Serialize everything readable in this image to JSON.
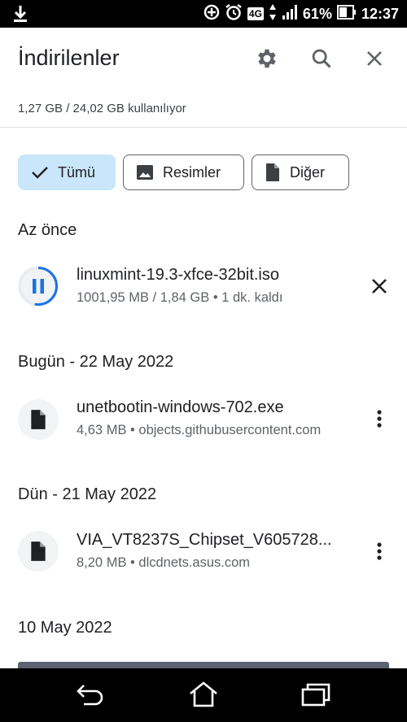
{
  "status_bar": {
    "network": "4G",
    "battery": "61%",
    "time": "12:37"
  },
  "header": {
    "title": "İndirilenler",
    "icons": [
      "gear-icon",
      "search-icon",
      "close-icon"
    ]
  },
  "storage_text": "1,27 GB / 24,02 GB kullanılıyor",
  "chips": [
    {
      "label": "Tümü",
      "icon": "check-icon",
      "selected": true
    },
    {
      "label": "Resimler",
      "icon": "image-icon",
      "selected": false
    },
    {
      "label": "Diğer",
      "icon": "file-icon",
      "selected": false
    }
  ],
  "sections": [
    {
      "heading": "Az önce",
      "items": [
        {
          "name": "linuxmint-19.3-xfce-32bit.iso",
          "meta": "1001,95 MB / 1,84 GB • 1 dk. kaldı",
          "icon": "pause-icon",
          "action": "close-icon",
          "progress": 0.53
        }
      ]
    },
    {
      "heading": "Bugün - 22 May 2022",
      "items": [
        {
          "name": "unetbootin-windows-702.exe",
          "meta": "4,63 MB • objects.githubusercontent.com",
          "icon": "file-icon",
          "action": "more-vert-icon"
        }
      ]
    },
    {
      "heading": "Dün - 21 May 2022",
      "items": [
        {
          "name": "VIA_VT8237S_Chipset_V605728...",
          "meta": "8,20 MB • dlcdnets.asus.com",
          "icon": "file-icon",
          "action": "more-vert-icon"
        }
      ]
    },
    {
      "heading": "10 May 2022",
      "items": []
    }
  ],
  "colors": {
    "accent": "#1a73e8",
    "chip_selected": "#c9e6fa",
    "text": "#202124",
    "secondary": "#5f6368"
  }
}
